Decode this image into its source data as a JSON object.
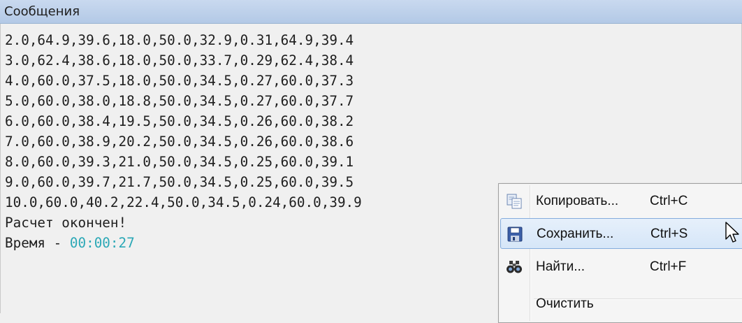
{
  "panel": {
    "title": "Сообщения"
  },
  "log": {
    "lines": [
      "2.0,64.9,39.6,18.0,50.0,32.9,0.31,64.9,39.4",
      "3.0,62.4,38.6,18.0,50.0,33.7,0.29,62.4,38.4",
      "4.0,60.0,37.5,18.0,50.0,34.5,0.27,60.0,37.3",
      "5.0,60.0,38.0,18.8,50.0,34.5,0.27,60.0,37.7",
      "6.0,60.0,38.4,19.5,50.0,34.5,0.26,60.0,38.2",
      "7.0,60.0,38.9,20.2,50.0,34.5,0.26,60.0,38.6",
      "8.0,60.0,39.3,21.0,50.0,34.5,0.25,60.0,39.1",
      "9.0,60.0,39.7,21.7,50.0,34.5,0.25,60.0,39.5",
      "10.0,60.0,40.2,22.4,50.0,34.5,0.24,60.0,39.9"
    ],
    "done_message": "Расчет окончен!",
    "time_label": "Время - ",
    "time_value": "00:00:27",
    "time_color": "#2ba8b6"
  },
  "context_menu": {
    "items": [
      {
        "label": "Копировать...",
        "shortcut": "Ctrl+C",
        "icon": "copy-icon"
      },
      {
        "label": "Сохранить...",
        "shortcut": "Ctrl+S",
        "icon": "save-icon",
        "highlighted": true
      },
      {
        "label": "Найти...",
        "shortcut": "Ctrl+F",
        "icon": "binoculars-icon"
      },
      {
        "label": "Очистить",
        "shortcut": "",
        "icon": ""
      }
    ],
    "highlight_color": "#d6e6f8"
  }
}
